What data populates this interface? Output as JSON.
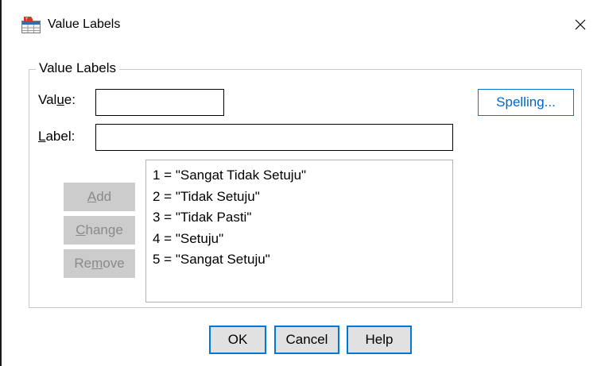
{
  "window": {
    "title": "Value Labels",
    "icon": "value-labels-app-icon",
    "close_glyph": "✕"
  },
  "group": {
    "legend": "Value Labels"
  },
  "value_field": {
    "label_before": "Val",
    "label_mnemonic": "u",
    "label_after": "e:",
    "value": ""
  },
  "label_field": {
    "label_mnemonic": "L",
    "label_after": "abel:",
    "value": ""
  },
  "spelling_button": {
    "label": "Spelling..."
  },
  "action_buttons": {
    "add": {
      "mnemonic": "A",
      "rest": "dd",
      "enabled": false
    },
    "change": {
      "mnemonic": "C",
      "rest": "hange",
      "enabled": false
    },
    "remove": {
      "before": "Re",
      "mnemonic": "m",
      "after": "ove",
      "enabled": false
    }
  },
  "value_list": [
    "1 = \"Sangat Tidak Setuju\"",
    "2 = \"Tidak Setuju\"",
    "3 = \"Tidak Pasti\"",
    "4 = \"Setuju\"",
    "5 = \"Sangat Setuju\""
  ],
  "footer_buttons": {
    "ok": "OK",
    "cancel": "Cancel",
    "help": "Help"
  },
  "colors": {
    "accent": "#0078d7",
    "disabled_bg": "#cccccc",
    "disabled_text": "#8a8a8a"
  }
}
